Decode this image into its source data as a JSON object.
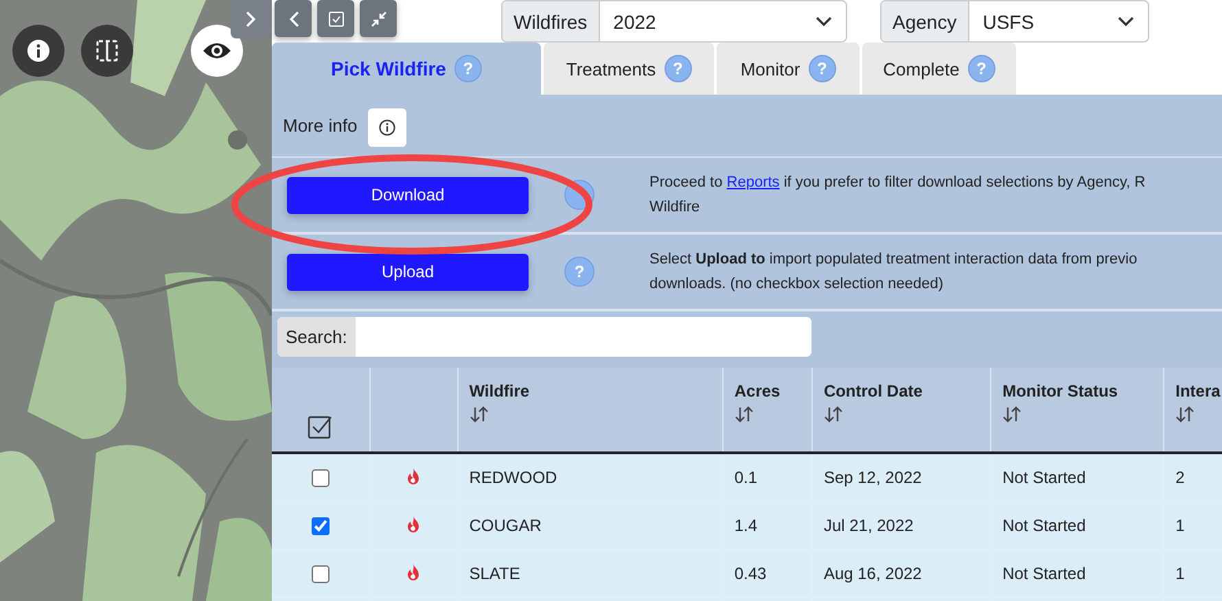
{
  "filters": [
    {
      "label": "Wildfires",
      "value": "2022"
    },
    {
      "label": "Agency",
      "value": "USFS"
    }
  ],
  "tabs": [
    {
      "label": "Pick Wildfire",
      "selected": true,
      "help": "?"
    },
    {
      "label": "Treatments",
      "selected": false,
      "help": "?"
    },
    {
      "label": "Monitor",
      "selected": false,
      "help": "?"
    },
    {
      "label": "Complete",
      "selected": false,
      "help": "?"
    }
  ],
  "more_info": {
    "label": "More info"
  },
  "actions": [
    {
      "button": "Download",
      "lines": [
        [
          {
            "kind": "plain",
            "text": "Proceed to"
          },
          {
            "kind": "link",
            "text": "Reports"
          },
          {
            "kind": "plain",
            "text": "if you prefer to filter download selections by Agency, R"
          }
        ],
        [
          {
            "kind": "plain",
            "text": "Wildfire"
          }
        ]
      ]
    },
    {
      "button": "Upload",
      "help": "?",
      "lines": [
        [
          {
            "kind": "plain",
            "text": "Select **Upload to** import populated treatment interaction data from previo"
          }
        ],
        [
          {
            "kind": "plain",
            "text": "downloads. (no checkbox selection needed)"
          }
        ]
      ]
    }
  ],
  "search": {
    "label": "Search:"
  },
  "table": {
    "columns": [
      "Wildfire",
      "Acres",
      "Control Date",
      "Monitor Status",
      "Intera"
    ],
    "rows": [
      {
        "checked": false,
        "cells": [
          "REDWOOD",
          "0.1",
          "Sep 12, 2022",
          "Not Started",
          "2"
        ]
      },
      {
        "checked": true,
        "cells": [
          "COUGAR",
          "1.4",
          "Jul 21, 2022",
          "Not Started",
          "1"
        ]
      },
      {
        "checked": false,
        "cells": [
          "SLATE",
          "0.43",
          "Aug 16, 2022",
          "Not Started",
          "1"
        ]
      }
    ]
  }
}
